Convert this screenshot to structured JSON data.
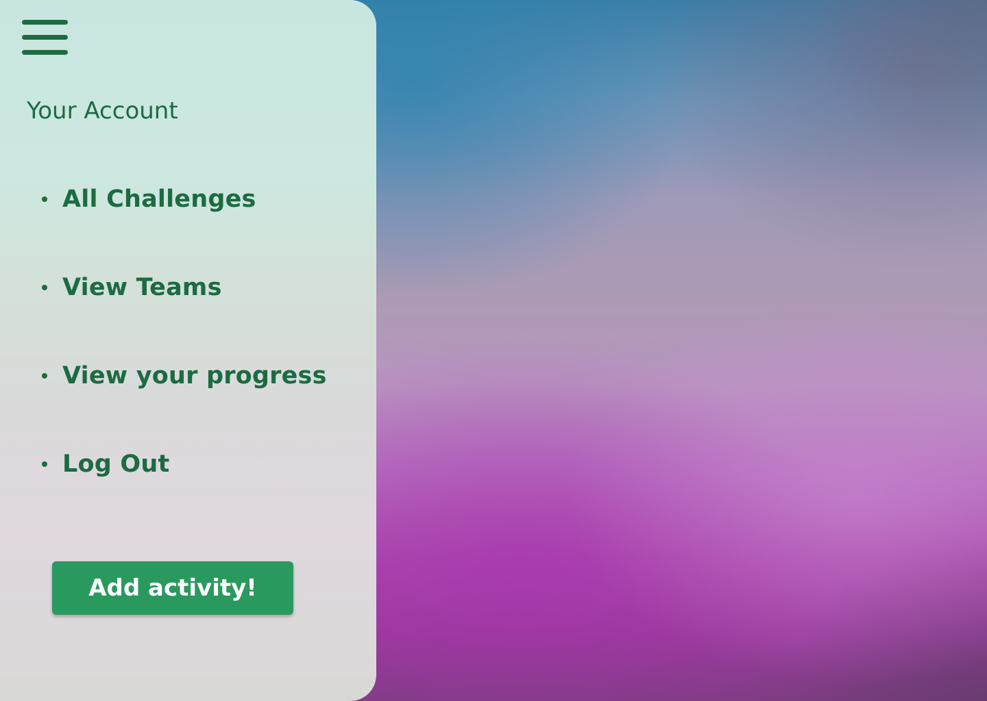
{
  "colors": {
    "brand_green": "#1c6b42",
    "button_green": "#2a995e",
    "button_text": "#ffffff",
    "panel_background": "#cce8e0"
  },
  "sidebar": {
    "menu_icon": "hamburger-menu-icon",
    "title": "Your Account",
    "items": [
      {
        "label": "All Challenges"
      },
      {
        "label": "View Teams"
      },
      {
        "label": "View your progress"
      },
      {
        "label": "Log Out"
      }
    ],
    "add_activity_label": "Add activity!"
  }
}
